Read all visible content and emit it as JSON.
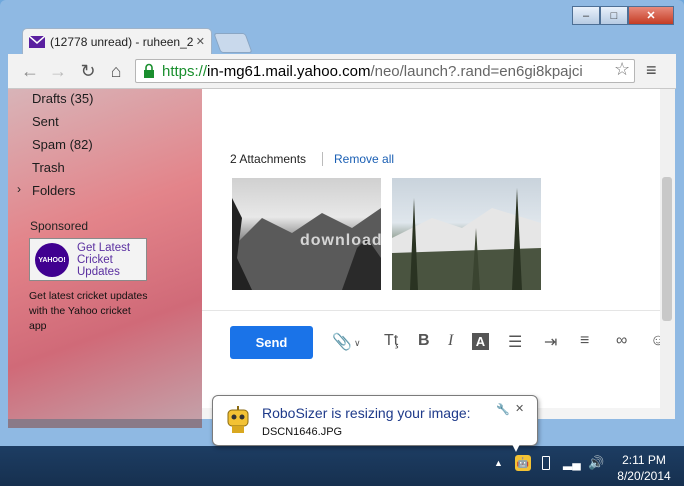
{
  "browser": {
    "tab_title": "(12778 unread) - ruheen_2",
    "url_scheme": "https://",
    "url_host": "in-mg61.mail.yahoo.com",
    "url_path": "/neo/launch?.rand=en6gi8kpajci"
  },
  "sidebar": {
    "items": [
      {
        "label": "Drafts (35)"
      },
      {
        "label": "Sent"
      },
      {
        "label": "Spam (82)"
      },
      {
        "label": "Trash"
      },
      {
        "label": "Folders"
      }
    ],
    "sponsored_label": "Sponsored",
    "ad_logo_text": "YAHOO!",
    "ad_title": "Get Latest Cricket Updates",
    "ad_body": "Get latest cricket updates with the Yahoo cricket app"
  },
  "compose": {
    "attachments_label": "2 Attachments",
    "remove_all_label": "Remove all",
    "send_label": "Send",
    "watermark_text": "download"
  },
  "notification": {
    "title": "RoboSizer is resizing your image:",
    "filename": "DSCN1646.JPG"
  },
  "taskbar": {
    "time": "2:11 PM",
    "date": "8/20/2014"
  },
  "colors": {
    "link": "#1a5fb4",
    "send_button": "#1a73e8",
    "yahoo_purple": "#400090",
    "secure_green": "#1a8f2e"
  }
}
